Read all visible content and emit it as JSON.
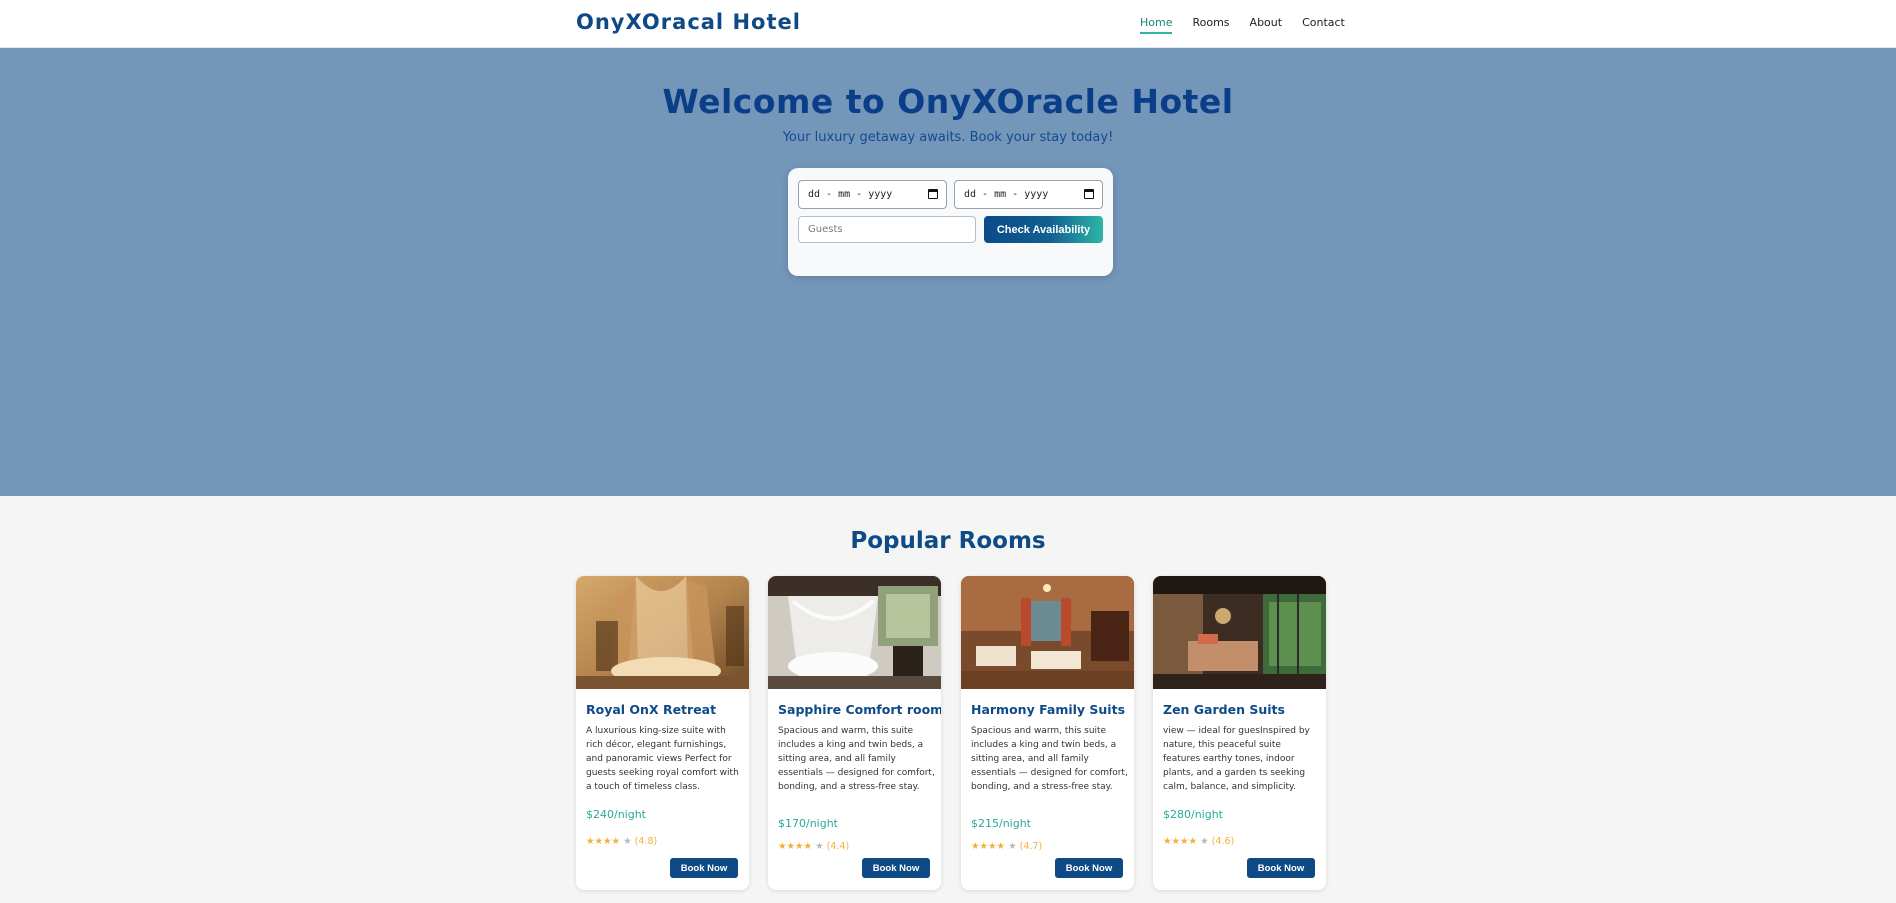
{
  "header": {
    "brand": "OnyXOracal Hotel",
    "nav": [
      "Home",
      "Rooms",
      "About",
      "Contact"
    ]
  },
  "hero": {
    "title": "Welcome to OnyXOracle Hotel",
    "subtitle": "Your luxury getaway awaits. Book your stay today!",
    "checkin_placeholder": "dd - mm - yyyy",
    "checkout_placeholder": "dd - mm - yyyy",
    "guests_placeholder": "Guests",
    "check_label": "Check Availability"
  },
  "rooms": {
    "title": "Popular Rooms",
    "items": [
      {
        "name": "Royal OnX Retreat",
        "description": "A luxurious king-size suite with rich décor, elegant furnishings, and panoramic views Perfect for guests seeking royal comfort with a touch of timeless class.",
        "price": "$240/night",
        "stars": "★★★★",
        "stars_off": "★",
        "rating": "(4.8)",
        "book_label": "Book Now"
      },
      {
        "name": "Sapphire Comfort room",
        "description": "Spacious and warm, this suite includes a king and twin beds, a sitting area, and all family essentials — designed for comfort, bonding, and a stress-free stay.",
        "price": "$170/night",
        "stars": "★★★★",
        "stars_off": "★",
        "rating": "(4.4)",
        "book_label": "Book Now"
      },
      {
        "name": "Harmony Family Suits",
        "description": "Spacious and warm, this suite includes a king and twin beds, a sitting area, and all family essentials — designed for comfort, bonding, and a stress-free stay.",
        "price": "$215/night",
        "stars": "★★★★",
        "stars_off": "★",
        "rating": "(4.7)",
        "book_label": "Book Now"
      },
      {
        "name": "Zen Garden Suits",
        "description": "view — ideal for guesInspired by nature, this peaceful suite features earthy tones, indoor plants, and a garden ts seeking calm, balance, and simplicity.",
        "price": "$280/night",
        "stars": "★★★★",
        "stars_off": "★",
        "rating": "(4.6)",
        "book_label": "Book Now"
      }
    ]
  },
  "colors": {
    "brand": "#0d4a86",
    "accent": "#2fb5a6",
    "hero_bg": "#7496b9",
    "star": "#f2b134"
  }
}
